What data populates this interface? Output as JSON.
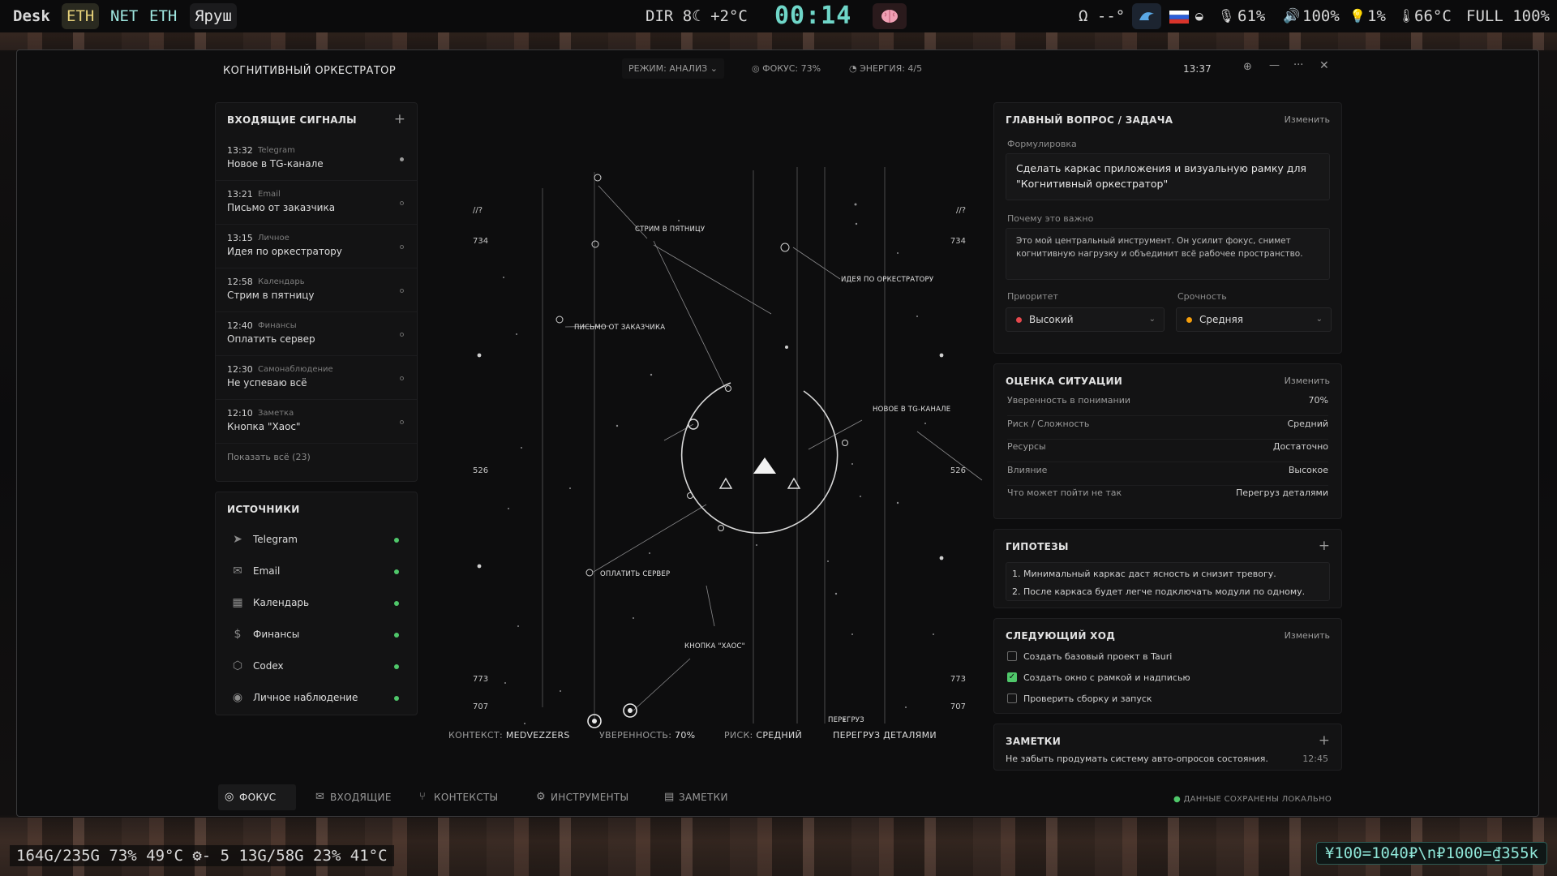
{
  "topbar": {
    "workspace": "Desk",
    "eth1": "ETH",
    "net": "NET",
    "eth2": "ETH",
    "layout": "Яруш",
    "weather": "DIR 8☾ +2°C",
    "clock": "00:14",
    "omega": "Ω --°",
    "battery": "61%",
    "volume": "100%",
    "brightness": "1%",
    "temp": "66°C",
    "full": "FULL 100%"
  },
  "bottombar": {
    "stats": "164G/235G 73% 49°C ⚙- 5 13G/58G 23% 41°C",
    "currency": "¥100=1040₽\\n₽1000=₫355k"
  },
  "window": {
    "title": "КОГНИТИВНЫЙ ОРКЕСТРАТОР",
    "mode": "РЕЖИМ: АНАЛИЗ",
    "focus": "ФОКУС: 73%",
    "energy": "ЭНЕРГИЯ: 4/5",
    "time": "13:37"
  },
  "incoming": {
    "title": "ВХОДЯЩИЕ СИГНАЛЫ",
    "items": [
      {
        "time": "13:32",
        "category": "Telegram",
        "text": "Новое в TG-канале"
      },
      {
        "time": "13:21",
        "category": "Email",
        "text": "Письмо от заказчика"
      },
      {
        "time": "13:15",
        "category": "Личное",
        "text": "Идея по оркестратору"
      },
      {
        "time": "12:58",
        "category": "Календарь",
        "text": "Стрим в пятницу"
      },
      {
        "time": "12:40",
        "category": "Финансы",
        "text": "Оплатить сервер"
      },
      {
        "time": "12:30",
        "category": "Самонаблюдение",
        "text": "Не успеваю всё"
      },
      {
        "time": "12:10",
        "category": "Заметка",
        "text": "Кнопка \"Хаос\""
      }
    ],
    "show_all": "Показать всё (23)"
  },
  "sources": {
    "title": "ИСТОЧНИКИ",
    "items": [
      {
        "icon": "send-icon",
        "label": "Telegram"
      },
      {
        "icon": "mail-icon",
        "label": "Email"
      },
      {
        "icon": "calendar-icon",
        "label": "Календарь"
      },
      {
        "icon": "dollar-icon",
        "label": "Финансы"
      },
      {
        "icon": "cube-icon",
        "label": "Codex"
      },
      {
        "icon": "eye-icon",
        "label": "Личное наблюдение"
      }
    ]
  },
  "graph": {
    "side_top": "//?",
    "side_734": "734",
    "side_526": "526",
    "side_773": "773",
    "side_707": "707",
    "nodes": {
      "stream": "СТРИМ В ПЯТНИЦУ",
      "idea": "ИДЕЯ ПО ОРКЕСТРАТОРУ",
      "letter": "ПИСЬМО ОТ ЗАКАЗЧИКА",
      "tg": "НОВОЕ В TG-КАНАЛЕ",
      "pay": "ОПЛАТИТЬ СЕРВЕР",
      "chaos": "КНОПКА \"ХАОС\"",
      "overload": "ПЕРЕГРУЗ"
    }
  },
  "context_bar": {
    "context_label": "КОНТЕКСТ:",
    "context_value": "MEDVEZZERS",
    "confidence_label": "УВЕРЕННОСТЬ:",
    "confidence_value": "70%",
    "risk_label": "РИСК:",
    "risk_value": "СРЕДНИЙ",
    "overload": "ПЕРЕГРУЗ ДЕТАЛЯМИ"
  },
  "tabs": [
    "ФОКУС",
    "ВХОДЯЩИЕ",
    "КОНТЕКСТЫ",
    "ИНСТРУМЕНТЫ",
    "ЗАМЕТКИ"
  ],
  "main_question": {
    "title": "ГЛАВНЫЙ ВОПРОС / ЗАДАЧА",
    "edit": "Изменить",
    "formulation_label": "Формулировка",
    "formulation": "Сделать каркас приложения и визуальную рамку для \"Когнитивный оркестратор\"",
    "why_label": "Почему это важно",
    "why": "Это мой центральный инструмент. Он усилит фокус, снимет когнитивную нагрузку и объединит всё рабочее пространство.",
    "priority_label": "Приоритет",
    "priority": "Высокий",
    "priority_color": "#e5484d",
    "urgency_label": "Срочность",
    "urgency": "Средняя",
    "urgency_color": "#f59e0b"
  },
  "assessment": {
    "title": "ОЦЕНКА СИТУАЦИИ",
    "edit": "Изменить",
    "rows": [
      {
        "label": "Уверенность в понимании",
        "value": "70%"
      },
      {
        "label": "Риск / Сложность",
        "value": "Средний"
      },
      {
        "label": "Ресурсы",
        "value": "Достаточно"
      },
      {
        "label": "Влияние",
        "value": "Высокое"
      },
      {
        "label": "Что может пойти не так",
        "value": "Перегруз деталями"
      }
    ]
  },
  "hypotheses": {
    "title": "ГИПОТЕЗЫ",
    "items": [
      "1. Минимальный каркас даст ясность и снизит тревогу.",
      "2. После каркаса будет легче подключать модули по одному."
    ]
  },
  "next_move": {
    "title": "СЛЕДУЮЩИЙ ХОД",
    "edit": "Изменить",
    "steps": [
      {
        "text": "Создать базовый проект в Tauri",
        "done": false
      },
      {
        "text": "Создать окно с рамкой и надписью",
        "done": true
      },
      {
        "text": "Проверить сборку и запуск",
        "done": false
      }
    ]
  },
  "notes": {
    "title": "ЗАМЕТКИ",
    "text": "Не забыть продумать систему авто-опросов состояния.",
    "time": "12:45"
  },
  "saved": "ДАННЫЕ СОХРАНЕНЫ ЛОКАЛЬНО"
}
